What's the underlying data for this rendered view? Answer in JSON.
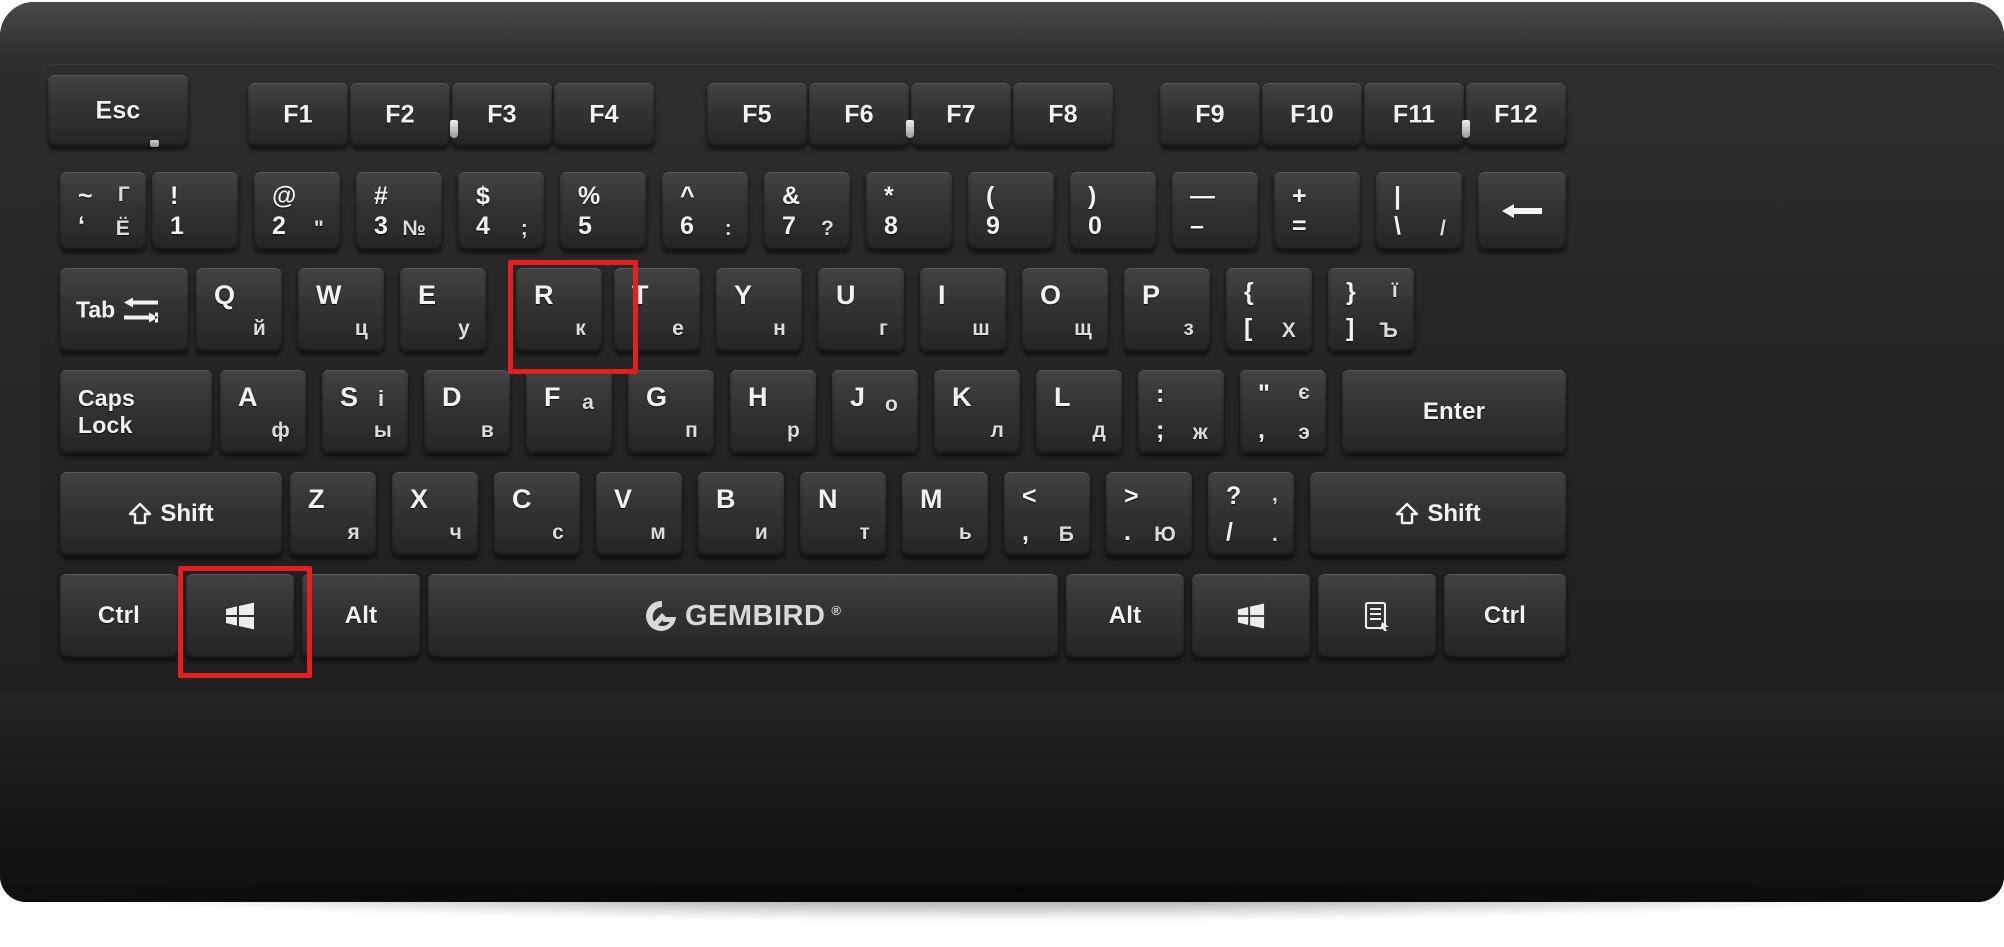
{
  "device": {
    "brand": "GEMBIRD",
    "registered_mark": "®",
    "layout": "Latin / Cyrillic (RU-UA)",
    "accent_highlight_color": "#e41f1f",
    "case_color": "#262626",
    "key_color": "#343434",
    "legend_color": "#f2f2f2"
  },
  "highlights": [
    {
      "name": "r-key",
      "label": "R"
    },
    {
      "name": "windows-key",
      "label": "Windows"
    }
  ],
  "rows": {
    "function": [
      {
        "name": "esc",
        "main": "Esc"
      },
      {
        "name": "f1",
        "main": "F1"
      },
      {
        "name": "f2",
        "main": "F2"
      },
      {
        "name": "f3",
        "main": "F3"
      },
      {
        "name": "f4",
        "main": "F4"
      },
      {
        "name": "f5",
        "main": "F5"
      },
      {
        "name": "f6",
        "main": "F6"
      },
      {
        "name": "f7",
        "main": "F7"
      },
      {
        "name": "f8",
        "main": "F8"
      },
      {
        "name": "f9",
        "main": "F9"
      },
      {
        "name": "f10",
        "main": "F10"
      },
      {
        "name": "f11",
        "main": "F11"
      },
      {
        "name": "f12",
        "main": "F12"
      }
    ],
    "number": [
      {
        "name": "backquote",
        "sym": "~",
        "symcyr": "Г",
        "num": "‘",
        "numcyr": "Ё"
      },
      {
        "name": "digit-1",
        "sym": "!",
        "symcyr": "",
        "num": "1",
        "numcyr": ""
      },
      {
        "name": "digit-2",
        "sym": "@",
        "symcyr": "",
        "num": "2",
        "numcyr": "\""
      },
      {
        "name": "digit-3",
        "sym": "#",
        "symcyr": "",
        "num": "3",
        "numcyr": "№"
      },
      {
        "name": "digit-4",
        "sym": "$",
        "symcyr": "",
        "num": "4",
        "numcyr": ";"
      },
      {
        "name": "digit-5",
        "sym": "%",
        "symcyr": "",
        "num": "5",
        "numcyr": ""
      },
      {
        "name": "digit-6",
        "sym": "^",
        "symcyr": "",
        "num": "6",
        "numcyr": ":"
      },
      {
        "name": "digit-7",
        "sym": "&",
        "symcyr": "",
        "num": "7",
        "numcyr": "?"
      },
      {
        "name": "digit-8",
        "sym": "*",
        "symcyr": "",
        "num": "8",
        "numcyr": ""
      },
      {
        "name": "digit-9",
        "sym": "(",
        "symcyr": "",
        "num": "9",
        "numcyr": ""
      },
      {
        "name": "digit-0",
        "sym": ")",
        "symcyr": "",
        "num": "0",
        "numcyr": ""
      },
      {
        "name": "minus",
        "sym": "—",
        "symcyr": "",
        "num": "–",
        "numcyr": ""
      },
      {
        "name": "equal",
        "sym": "+",
        "symcyr": "",
        "num": "=",
        "numcyr": ""
      },
      {
        "name": "backslash",
        "sym": "|",
        "symcyr": "",
        "num": "\\",
        "numcyr": "/"
      },
      {
        "name": "backspace",
        "main": "←"
      }
    ],
    "qwerty": [
      {
        "name": "tab",
        "main": "Tab"
      },
      {
        "name": "key-q",
        "lat": "Q",
        "cyr": "й"
      },
      {
        "name": "key-w",
        "lat": "W",
        "cyr": "ц"
      },
      {
        "name": "key-e",
        "lat": "E",
        "cyr": "у"
      },
      {
        "name": "key-r",
        "lat": "R",
        "cyr": "к"
      },
      {
        "name": "key-t",
        "lat": "T",
        "cyr": "е"
      },
      {
        "name": "key-y",
        "lat": "Y",
        "cyr": "н"
      },
      {
        "name": "key-u",
        "lat": "U",
        "cyr": "г"
      },
      {
        "name": "key-i",
        "lat": "I",
        "cyr": "ш"
      },
      {
        "name": "key-o",
        "lat": "O",
        "cyr": "щ"
      },
      {
        "name": "key-p",
        "lat": "P",
        "cyr": "з"
      },
      {
        "name": "bracket-left",
        "lat": "{",
        "cyr": "",
        "lat2": "",
        "sub_lat": "[",
        "sub_cyr": "Х"
      },
      {
        "name": "bracket-right",
        "lat": "}",
        "cyr": "ї",
        "sub_lat": "]",
        "sub_cyr": "Ъ"
      }
    ],
    "home": [
      {
        "name": "caps-lock",
        "line1": "Caps",
        "line2": "Lock"
      },
      {
        "name": "key-a",
        "lat": "A",
        "cyr": "ф"
      },
      {
        "name": "key-s",
        "lat": "S",
        "lat_alt": "i",
        "cyr": "ы"
      },
      {
        "name": "key-d",
        "lat": "D",
        "cyr": "в"
      },
      {
        "name": "key-f",
        "lat": "F",
        "cyr": "а"
      },
      {
        "name": "key-g",
        "lat": "G",
        "cyr": "п"
      },
      {
        "name": "key-h",
        "lat": "H",
        "cyr": "р"
      },
      {
        "name": "key-j",
        "lat": "J",
        "cyr": "о"
      },
      {
        "name": "key-k",
        "lat": "K",
        "cyr": "л"
      },
      {
        "name": "key-l",
        "lat": "L",
        "cyr": "д"
      },
      {
        "name": "semicolon",
        "lat": ":",
        "sub_lat": ";",
        "sub_cyr": "ж"
      },
      {
        "name": "quote",
        "lat": "\"",
        "cyr": "є",
        "sub_lat": ",",
        "sub_cyr": "э"
      },
      {
        "name": "enter",
        "main": "Enter"
      }
    ],
    "shift": [
      {
        "name": "shift-left",
        "main": "Shift"
      },
      {
        "name": "key-z",
        "lat": "Z",
        "cyr": "я"
      },
      {
        "name": "key-x",
        "lat": "X",
        "cyr": "ч"
      },
      {
        "name": "key-c",
        "lat": "C",
        "cyr": "с"
      },
      {
        "name": "key-v",
        "lat": "V",
        "cyr": "м"
      },
      {
        "name": "key-b",
        "lat": "B",
        "cyr": "и"
      },
      {
        "name": "key-n",
        "lat": "N",
        "cyr": "т"
      },
      {
        "name": "key-m",
        "lat": "M",
        "cyr": "ь"
      },
      {
        "name": "comma",
        "lat": "<",
        "sub_lat": ",",
        "sub_cyr": "Б"
      },
      {
        "name": "period",
        "lat": ">",
        "sub_lat": ".",
        "sub_cyr": "Ю"
      },
      {
        "name": "slash",
        "lat": "?",
        "cyr": ",",
        "sub_lat": "/",
        "sub_cyr": "."
      },
      {
        "name": "shift-right",
        "main": "Shift"
      }
    ],
    "bottom": [
      {
        "name": "ctrl-left",
        "main": "Ctrl"
      },
      {
        "name": "win-left",
        "main": ""
      },
      {
        "name": "alt-left",
        "main": "Alt"
      },
      {
        "name": "space",
        "main": ""
      },
      {
        "name": "alt-right",
        "main": "Alt"
      },
      {
        "name": "win-right",
        "main": ""
      },
      {
        "name": "menu",
        "main": ""
      },
      {
        "name": "ctrl-right",
        "main": "Ctrl"
      }
    ]
  }
}
